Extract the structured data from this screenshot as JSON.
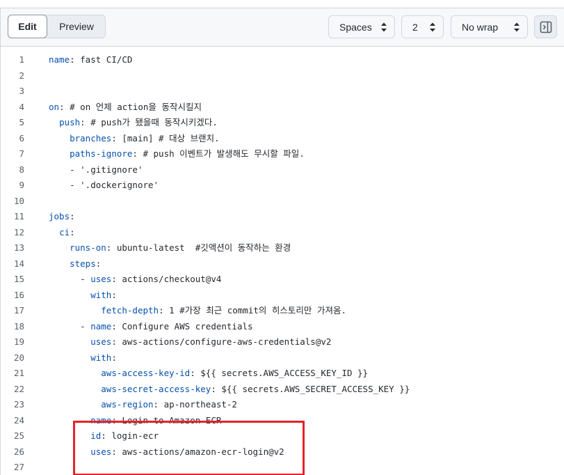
{
  "toolbar": {
    "tab_edit": "Edit",
    "tab_preview": "Preview",
    "indent_mode": "Spaces",
    "indent_size": "2",
    "wrap_mode": "No wrap",
    "sidebar_toggle_icon": "sidebar-panel-icon"
  },
  "highlight": {
    "color": "#e3232b",
    "from_line": 24,
    "to_line": 26
  },
  "lines": [
    {
      "n": "1",
      "indent": "",
      "key": "name",
      "rest": ": fast CI/CD"
    },
    {
      "n": "2",
      "indent": "",
      "key": "",
      "rest": ""
    },
    {
      "n": "3",
      "indent": "",
      "key": "",
      "rest": ""
    },
    {
      "n": "4",
      "indent": "",
      "key": "on",
      "rest": ": # on 언제 action을 동작시킬지"
    },
    {
      "n": "5",
      "indent": "  ",
      "key": "push",
      "rest": ": # push가 됐을때 동작시키겠다."
    },
    {
      "n": "6",
      "indent": "    ",
      "key": "branches",
      "rest": ": [main] # 대상 브랜치."
    },
    {
      "n": "7",
      "indent": "    ",
      "key": "paths-ignore",
      "rest": ": # push 이벤트가 발생해도 무시할 파일."
    },
    {
      "n": "8",
      "indent": "    ",
      "key": "",
      "rest": "- '.gitignore'"
    },
    {
      "n": "9",
      "indent": "    ",
      "key": "",
      "rest": "- '.dockerignore'"
    },
    {
      "n": "10",
      "indent": "",
      "key": "",
      "rest": ""
    },
    {
      "n": "11",
      "indent": "",
      "key": "jobs",
      "rest": ":"
    },
    {
      "n": "12",
      "indent": "  ",
      "key": "ci",
      "rest": ":"
    },
    {
      "n": "13",
      "indent": "    ",
      "key": "runs-on",
      "rest": ": ubuntu-latest  #깃액션이 동작하는 환경"
    },
    {
      "n": "14",
      "indent": "    ",
      "key": "steps",
      "rest": ":"
    },
    {
      "n": "15",
      "indent": "      - ",
      "key": "uses",
      "rest": ": actions/checkout@v4"
    },
    {
      "n": "16",
      "indent": "        ",
      "key": "with",
      "rest": ":"
    },
    {
      "n": "17",
      "indent": "          ",
      "key": "fetch-depth",
      "rest": ": 1 #가장 최근 commit의 히스토리만 가져옴."
    },
    {
      "n": "18",
      "indent": "      - ",
      "key": "name",
      "rest": ": Configure AWS credentials"
    },
    {
      "n": "19",
      "indent": "        ",
      "key": "uses",
      "rest": ": aws-actions/configure-aws-credentials@v2"
    },
    {
      "n": "20",
      "indent": "        ",
      "key": "with",
      "rest": ":"
    },
    {
      "n": "21",
      "indent": "          ",
      "key": "aws-access-key-id",
      "rest": ": ${{ secrets.AWS_ACCESS_KEY_ID }}"
    },
    {
      "n": "22",
      "indent": "          ",
      "key": "aws-secret-access-key",
      "rest": ": ${{ secrets.AWS_SECRET_ACCESS_KEY }}"
    },
    {
      "n": "23",
      "indent": "          ",
      "key": "aws-region",
      "rest": ": ap-northeast-2"
    },
    {
      "n": "24",
      "indent": "      - ",
      "key": "name",
      "rest": ": Login to Amazon ECR"
    },
    {
      "n": "25",
      "indent": "        ",
      "key": "id",
      "rest": ": login-ecr"
    },
    {
      "n": "26",
      "indent": "        ",
      "key": "uses",
      "rest": ": aws-actions/amazon-ecr-login@v2"
    },
    {
      "n": "27",
      "indent": "",
      "key": "",
      "rest": ""
    }
  ]
}
